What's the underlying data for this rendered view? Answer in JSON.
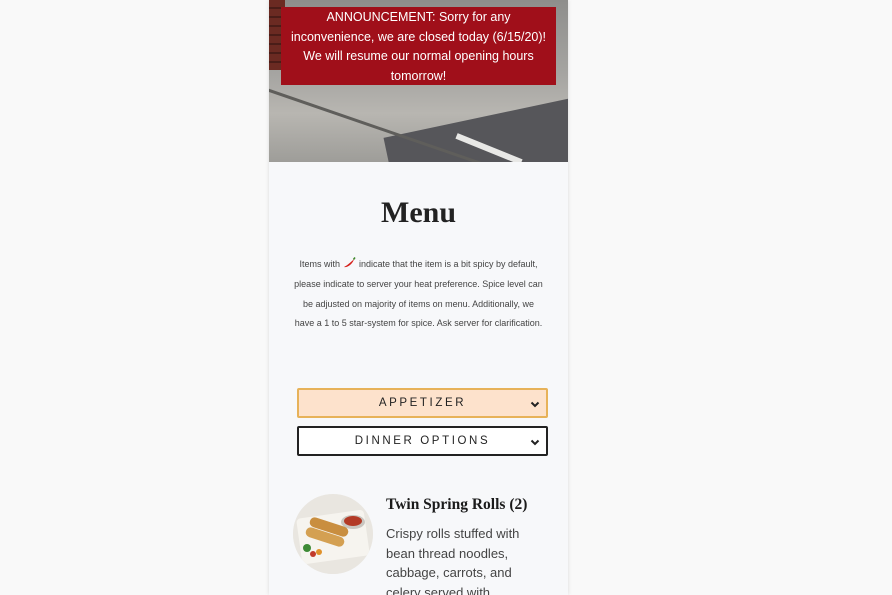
{
  "announcement": {
    "text": "ANNOUNCEMENT: Sorry for any inconvenience, we are closed today (6/15/20)! We will resume our normal opening hours tomorrow!"
  },
  "menu": {
    "title": "Menu",
    "intro_before": "Items with ",
    "intro_after": " indicate that the item is a bit spicy by default, please indicate to server your heat preference. Spice level can be adjusted on majority of items on menu. Additionally, we have a 1 to 5 star-system for spice. Ask server for clarification.",
    "spicy_icon": "chili-pepper-icon"
  },
  "category_selects": [
    {
      "label": "APPETIZER",
      "active": true
    },
    {
      "label": "DINNER OPTIONS",
      "active": false
    }
  ],
  "items": [
    {
      "name": "Twin Spring Rolls (2)",
      "description": "Crispy rolls stuffed with bean thread noodles, cabbage, carrots, and celery served with",
      "image_icon": "spring-rolls-photo"
    }
  ],
  "colors": {
    "announcement_bg": "#a00f1a",
    "active_select_bg": "#fde2cc",
    "active_select_border": "#e7b259"
  }
}
